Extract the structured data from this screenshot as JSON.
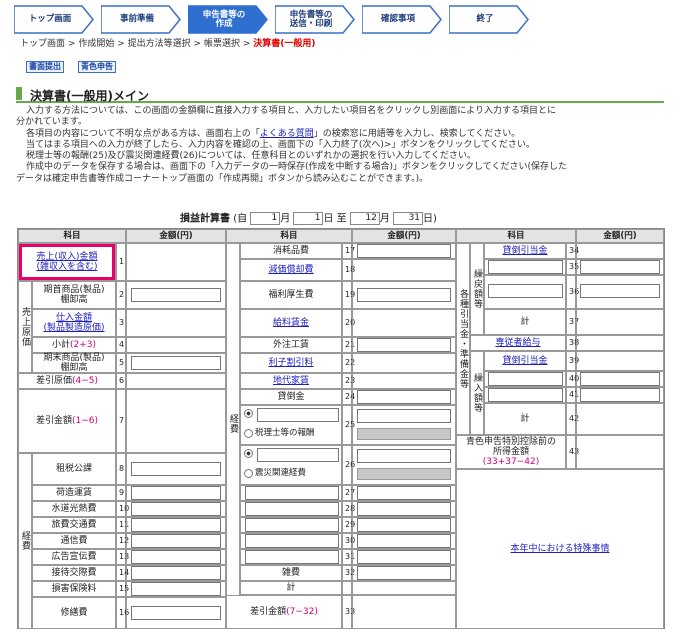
{
  "steps": [
    {
      "label": "トップ画面"
    },
    {
      "label": "事前準備"
    },
    {
      "label": "申告書等の\n作成"
    },
    {
      "label": "申告書等の\n送信・印刷"
    },
    {
      "label": "確認事項"
    },
    {
      "label": "終了"
    }
  ],
  "breadcrumb": {
    "items": [
      "トップ画面",
      "作成開始",
      "提出方法等選択",
      "帳票選択"
    ],
    "sep": ">",
    "current": "決算書(一般用)"
  },
  "small_buttons": {
    "shosai": "書面提出",
    "aoiro": "青色申告"
  },
  "page_title": "決算書(一般用)メイン",
  "intro": {
    "l1": "入力する方法については、この画面の金額欄に直接入力する項目と、入力したい項目名をクリックし別画面により入力する項目とに",
    "l2": "分かれています。",
    "l3a": "各項目の内容について不明な点がある方は、画面右上の「",
    "l3link": "よくある質問",
    "l3b": "」の検索窓に用語等を入力し、検索してください。",
    "l4": "当てはまる項目への入力が終了したら、入力内容を確認の上、画面下の「入力終了(次へ)>」ボタンをクリックしてください。",
    "l5": "税理士等の報酬(25)及び震災関連経費(26)については、任意科目とのいずれかの選択を行い入力してください。",
    "l6": "作成中のデータを保存する場合は、画面下の「入力データの一時保存(作成を中断する場合)」ボタンをクリックしてください(保存した",
    "l7": "データは確定申告書等作成コーナートップ画面の「作成再開」ボタンから読み込むことができます。)。"
  },
  "period": {
    "title": "損益計算書",
    "paren_open": "(自",
    "from_month": "1",
    "from_day": "1",
    "to_month": "12",
    "to_day": "31",
    "u_month": "月",
    "u_day": "日",
    "to": "至",
    "paren_close": "日)"
  },
  "headers": {
    "kamoku": "科目",
    "kingaku": "金額(円)"
  },
  "col1": {
    "r1": "売上(収入)金額\n(雑収入を含む)",
    "r2": "期首商品(製品)\n棚卸高",
    "r3": "仕入金額\n(製品製造原価)",
    "r4": "小計",
    "r4f": "(2+3)",
    "r5": "期末商品(製品)\n棚卸高",
    "r6": "差引原価",
    "r6f": "(4−5)",
    "r7": "差引金額",
    "r7f": "(1−6)",
    "r8": "租税公課",
    "r9": "荷造運賃",
    "r10": "水道光熱費",
    "r11": "旅費交通費",
    "r12": "通信費",
    "r13": "広告宣伝費",
    "r14": "接待交際費",
    "r15": "損害保険料",
    "r16": "修繕費",
    "genka": "売上原価",
    "keihi": "経費"
  },
  "col2": {
    "r17": "消耗品費",
    "r18": "減価償却費",
    "r19": "福利厚生費",
    "r20": "給料賃金",
    "r21": "外注工賃",
    "r22": "利子割引料",
    "r23": "地代家賃",
    "r24": "貸倒金",
    "r25": "税理士等の報酬",
    "r26": "震災関連経費",
    "r32": "雑費",
    "r33t": "計",
    "r33": "差引金額",
    "r33f": "(7−32)",
    "keihi": "経費"
  },
  "col3": {
    "r34": "貸倒引当金",
    "r37": "計",
    "r38": "専従者給与",
    "r39": "貸倒引当金",
    "r42": "計",
    "r43": "青色申告特別控除前の\n所得金額",
    "r43f": "(33+37−42)",
    "kuri_modoshi": "繰戻額等",
    "kuri_ire": "繰入額等",
    "group": "各種引当金・準備金等",
    "special": "本年中における特殊事情"
  },
  "nums": {
    "n1": "1",
    "n2": "2",
    "n3": "3",
    "n4": "4",
    "n5": "5",
    "n6": "6",
    "n7": "7",
    "n8": "8",
    "n9": "9",
    "n10": "10",
    "n11": "11",
    "n12": "12",
    "n13": "13",
    "n14": "14",
    "n15": "15",
    "n16": "16",
    "n17": "17",
    "n18": "18",
    "n19": "19",
    "n20": "20",
    "n21": "21",
    "n22": "22",
    "n23": "23",
    "n24": "24",
    "n25": "25",
    "n26": "26",
    "n27": "27",
    "n28": "28",
    "n29": "29",
    "n30": "30",
    "n31": "31",
    "n32": "32",
    "n33": "33",
    "n34": "34",
    "n35": "35",
    "n36": "36",
    "n37": "37",
    "n38": "38",
    "n39": "39",
    "n40": "40",
    "n41": "41",
    "n42": "42",
    "n43": "43"
  },
  "colors": {
    "accent": "#2e6fd0",
    "highlight": "#e8006a",
    "link": "#2020c0",
    "header_bg": "#e3e3e3",
    "title_bar": "#6aa84f"
  }
}
